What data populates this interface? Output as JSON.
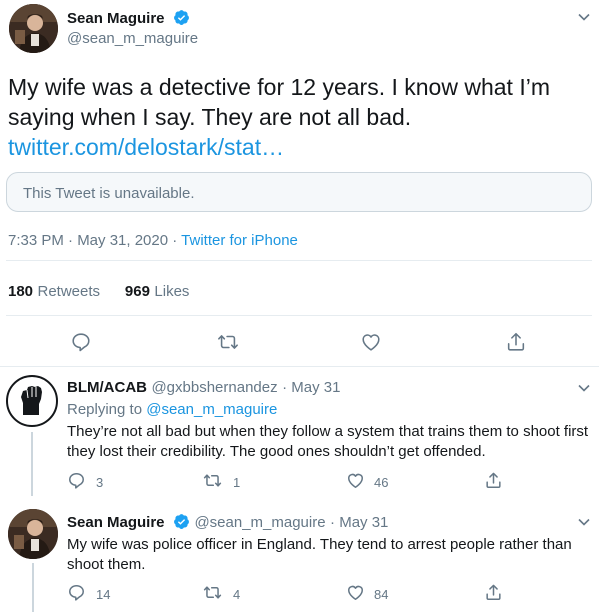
{
  "main_tweet": {
    "author_name": "Sean Maguire",
    "author_handle": "@sean_m_maguire",
    "text": "My wife was a detective for 12 years. I know what I’m saying when I say. They are not all bad.",
    "link": "twitter.com/delostark/stat…",
    "quoted_unavailable": "This Tweet is unavailable.",
    "timestamp": "7:33 PM · May 31, 2020",
    "separator": "·",
    "source": "Twitter for iPhone",
    "retweets_count": "180",
    "retweets_label": "Retweets",
    "likes_count": "969",
    "likes_label": "Likes"
  },
  "replies": [
    {
      "author_name": "BLM/ACAB",
      "author_handle": "@gxbbshernandez",
      "date": "· May 31",
      "replying_prefix": "Replying to",
      "replying_to": "@sean_m_maguire",
      "text": "They’re not all bad but when they follow a system that trains them to shoot first they lost their credibility. The good ones shouldn’t get offended.",
      "reply_count": "3",
      "retweet_count": "1",
      "like_count": "46"
    },
    {
      "author_name": "Sean Maguire",
      "author_handle": "@sean_m_maguire",
      "date": "· May 31",
      "text": "My wife was police officer in England.  They tend to arrest people rather than shoot them.",
      "reply_count": "14",
      "retweet_count": "4",
      "like_count": "84"
    }
  ],
  "colors": {
    "accent": "#1da1f2",
    "link": "#1b95e0",
    "muted": "#657786",
    "divider": "#e6ecf0"
  },
  "icons": [
    "verified-badge-icon",
    "chevron-down-icon",
    "reply-icon",
    "retweet-icon",
    "like-icon",
    "share-icon",
    "raised-fist-icon"
  ]
}
